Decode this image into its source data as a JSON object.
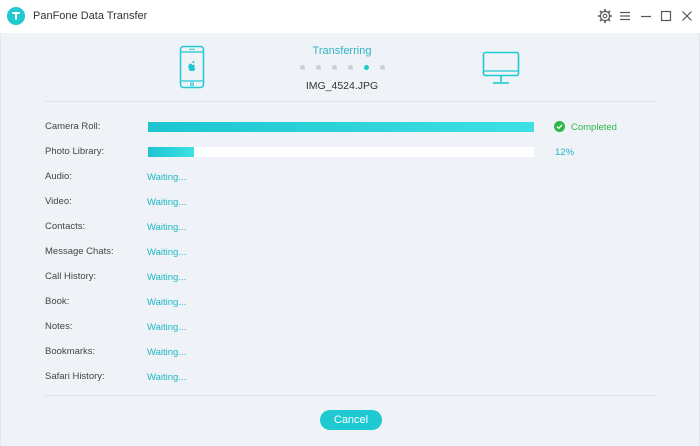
{
  "window": {
    "title": "PanFone Data Transfer",
    "accent_color": "#1ec9d2",
    "logo_icon": "panfone-logo-icon",
    "controls": [
      "settings-icon",
      "menu-icon",
      "minimize-icon",
      "maximize-icon",
      "close-icon"
    ]
  },
  "transfer": {
    "status": "Transferring",
    "current_file": "IMG_4524.JPG",
    "source_device_icon": "iphone-icon",
    "target_device_icon": "monitor-icon",
    "step_dots": 6,
    "active_dot": 4
  },
  "rows": [
    {
      "label": "Camera Roll:",
      "state": "completed",
      "status": "Completed",
      "progress": 1.0
    },
    {
      "label": "Photo Library:",
      "state": "in-progress",
      "status": "12%",
      "progress": 0.12
    },
    {
      "label": "Audio:",
      "state": "waiting",
      "status": "Waiting..."
    },
    {
      "label": "Video:",
      "state": "waiting",
      "status": "Waiting..."
    },
    {
      "label": "Contacts:",
      "state": "waiting",
      "status": "Waiting..."
    },
    {
      "label": "Message Chats:",
      "state": "waiting",
      "status": "Waiting..."
    },
    {
      "label": "Call History:",
      "state": "waiting",
      "status": "Waiting..."
    },
    {
      "label": "Book:",
      "state": "waiting",
      "status": "Waiting..."
    },
    {
      "label": "Notes:",
      "state": "waiting",
      "status": "Waiting..."
    },
    {
      "label": "Bookmarks:",
      "state": "waiting",
      "status": "Waiting..."
    },
    {
      "label": "Safari History:",
      "state": "waiting",
      "status": "Waiting..."
    }
  ],
  "footer": {
    "cancel_label": "Cancel"
  }
}
